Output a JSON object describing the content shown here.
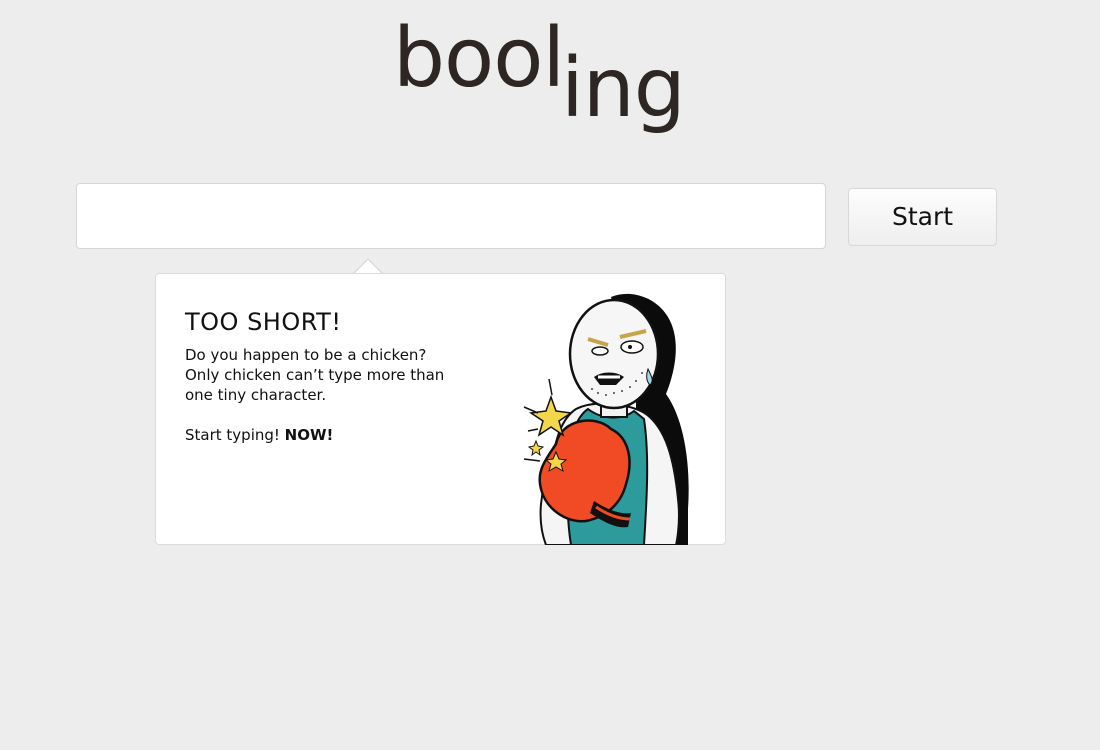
{
  "logo": {
    "part1": "bool",
    "part2": "ing"
  },
  "search": {
    "value": "",
    "placeholder": ""
  },
  "start_button": {
    "label": "Start"
  },
  "tooltip": {
    "title": "TOO SHORT!",
    "line1": "Do you happen to be a chicken?",
    "line2": "Only chicken can’t type more than",
    "line3": "one tiny character.",
    "cta_prefix": "Start typing! ",
    "cta_strong": "NOW!"
  },
  "illustration": {
    "icon": "boxer-illustration",
    "colors": {
      "glove": "#f04b25",
      "shirt": "#2d9a9c",
      "shadow": "#0b0b0b",
      "star": "#f4d64a"
    }
  }
}
